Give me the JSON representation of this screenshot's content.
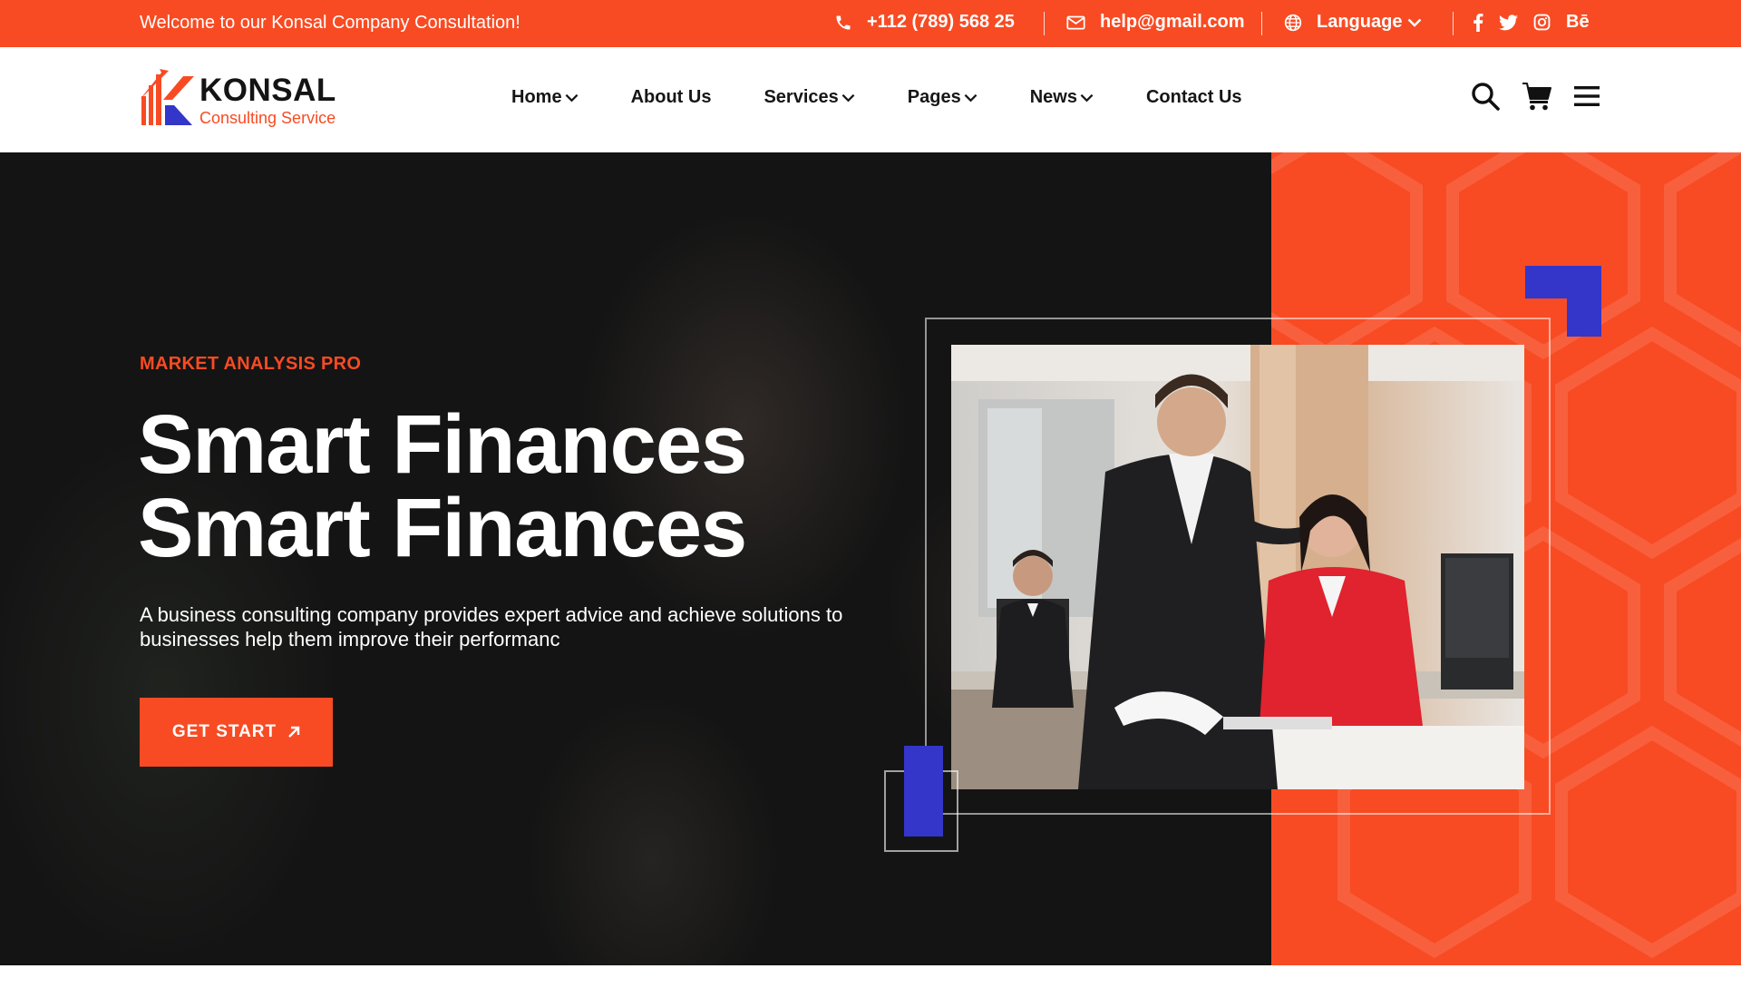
{
  "topbar": {
    "welcome": "Welcome to our Konsal Company Consultation!",
    "phone": "+112 (789) 568 25",
    "email": "help@gmail.com",
    "language": "Language",
    "social": [
      "facebook-icon",
      "twitter-icon",
      "instagram-icon",
      "behance-icon"
    ],
    "behance_label": "Bē"
  },
  "logo": {
    "name": "KONSAL",
    "tagline": "Consulting Service"
  },
  "nav": {
    "items": [
      {
        "label": "Home",
        "dropdown": true
      },
      {
        "label": "About Us",
        "dropdown": false
      },
      {
        "label": "Services",
        "dropdown": true
      },
      {
        "label": "Pages",
        "dropdown": true
      },
      {
        "label": "News",
        "dropdown": true
      },
      {
        "label": "Contact Us",
        "dropdown": false
      }
    ],
    "icons": [
      "search-icon",
      "cart-icon",
      "menu-icon"
    ]
  },
  "hero": {
    "eyebrow": "MARKET ANALYSIS PRO",
    "headline_line1": "Smart Finances",
    "headline_line2": "Smart Finances",
    "description": "A business consulting company provides expert advice and achieve solutions to businesses help them improve their performanc",
    "cta_label": "GET START"
  },
  "colors": {
    "accent": "#f84b23",
    "blue": "#3336c9",
    "dark": "#141414"
  }
}
